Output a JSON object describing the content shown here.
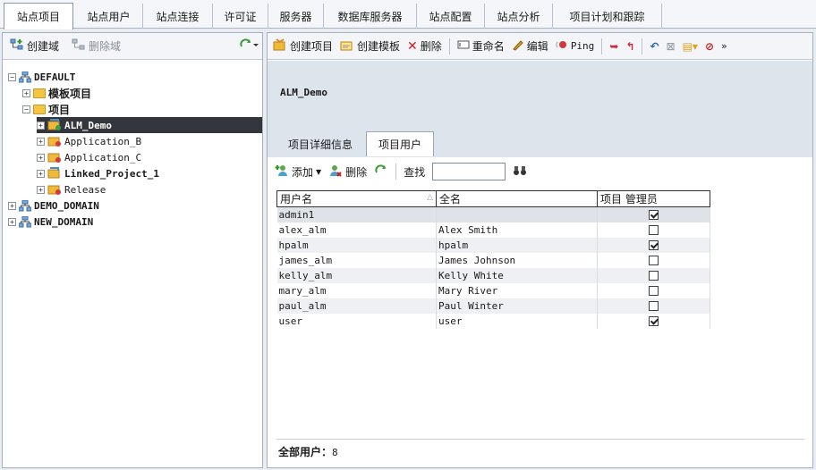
{
  "top_tabs": [
    "站点项目",
    "站点用户",
    "站点连接",
    "许可证",
    "服务器",
    "数据库服务器",
    "站点配置",
    "站点分析",
    "项目计划和跟踪"
  ],
  "left_toolbar": {
    "create_domain": "创建域",
    "delete_domain": "删除域"
  },
  "tree": {
    "default": "DEFAULT",
    "template_projects": "模板项目",
    "projects": "项目",
    "alm_demo": "ALM_Demo",
    "application_b": "Application_B",
    "application_c": "Application_C",
    "linked_project": "Linked_Project_1",
    "release": "Release",
    "demo_domain": "DEMO_DOMAIN",
    "new_domain": "NEW_DOMAIN"
  },
  "right_toolbar": {
    "create_project": "创建项目",
    "create_template": "创建模板",
    "delete": "删除",
    "rename": "重命名",
    "edit": "编辑",
    "ping": "Ping"
  },
  "project_title": "ALM_Demo",
  "subtabs": [
    "项目详细信息",
    "项目用户"
  ],
  "users_toolbar": {
    "add": "添加",
    "remove": "删除",
    "find_label": "查找",
    "search_value": ""
  },
  "table": {
    "headers": [
      "用户名",
      "全名",
      "项目 管理员"
    ],
    "rows": [
      {
        "username": "admin1",
        "fullname": "",
        "admin": true
      },
      {
        "username": "alex_alm",
        "fullname": "Alex Smith",
        "admin": false
      },
      {
        "username": "hpalm",
        "fullname": "hpalm",
        "admin": true
      },
      {
        "username": "james_alm",
        "fullname": "James Johnson",
        "admin": false
      },
      {
        "username": "kelly_alm",
        "fullname": "Kelly White",
        "admin": false
      },
      {
        "username": "mary_alm",
        "fullname": "Mary River",
        "admin": false
      },
      {
        "username": "paul_alm",
        "fullname": "Paul Winter",
        "admin": false
      },
      {
        "username": "user",
        "fullname": "user",
        "admin": true
      }
    ]
  },
  "footer": {
    "label": "全部用户：",
    "count": "8"
  },
  "colors": {
    "selection": "#33373d",
    "header_band": "#dde4ec",
    "folder": "#f4c542",
    "delete_red": "#cc1d1d"
  }
}
